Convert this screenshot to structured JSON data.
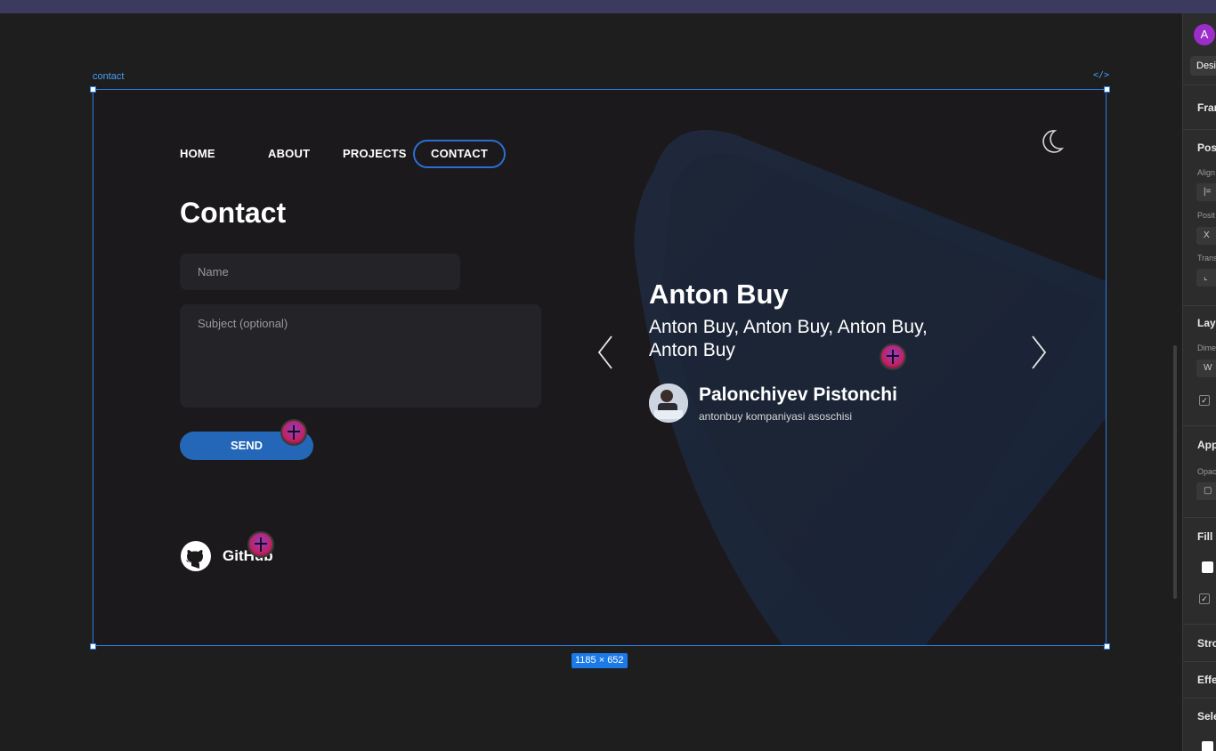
{
  "frame": {
    "label": "contact",
    "code_icon": "</>",
    "size_badge": "1185 × 652"
  },
  "nav": {
    "items": [
      {
        "label": "HOME",
        "active": false
      },
      {
        "label": "ABOUT",
        "active": false
      },
      {
        "label": "PROJECTS",
        "active": false
      },
      {
        "label": "CONTACT",
        "active": true
      }
    ]
  },
  "contact": {
    "title": "Contact",
    "name_placeholder": "Name",
    "subject_placeholder": "Subject (optional)",
    "send_label": "SEND",
    "github_label": "GitHub"
  },
  "testimonial": {
    "name": "Anton Buy",
    "text": "Anton Buy, Anton Buy, Anton Buy, Anton Buy",
    "person_name": "Palonchiyev Pistonchi",
    "person_role": "antonbuy kompaniyasi asoschisi"
  },
  "right_panel": {
    "avatar_letter": "A",
    "design_tab": "Desi",
    "frame_heading": "Fran",
    "position_heading": "Posi",
    "align_label": "Align",
    "position_label": "Posit",
    "x_label": "X",
    "transform_label": "Trans",
    "layout_heading": "Layo",
    "dimensions_label": "Dime",
    "w_label": "W",
    "appearance_heading": "App",
    "opacity_label": "Opac",
    "fill_heading": "Fill",
    "stroke_heading": "Stro",
    "effects_heading": "Effe",
    "selection_heading": "Sele"
  },
  "colors": {
    "accent": "#2a7de1",
    "send_button": "#2467b8",
    "frame_bg": "#1b191c",
    "canvas_bg": "#1e1e1e"
  }
}
